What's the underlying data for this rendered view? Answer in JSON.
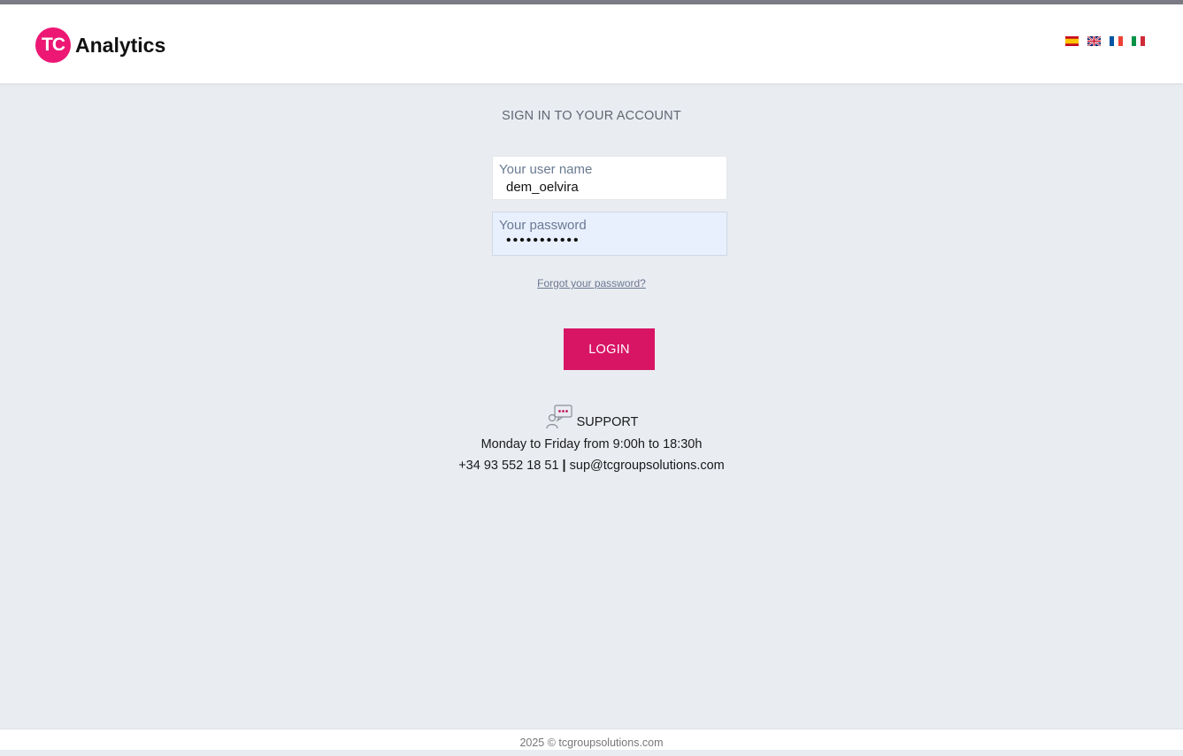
{
  "header": {
    "logo_badge": "TC",
    "logo_text": "Analytics",
    "languages": [
      {
        "name": "spanish-flag-icon"
      },
      {
        "name": "english-flag-icon"
      },
      {
        "name": "french-flag-icon"
      },
      {
        "name": "italian-flag-icon"
      }
    ]
  },
  "login": {
    "title": "SIGN IN TO YOUR ACCOUNT",
    "username_label": "Your user name",
    "username_value": "dem_oelvira",
    "password_label": "Your password",
    "password_value": "•••••••••••",
    "forgot_link": "Forgot your password?",
    "login_button": "LOGIN"
  },
  "support": {
    "icon": "support-chat-icon",
    "label": "SUPPORT",
    "hours": "Monday to Friday from 9:00h to 18:30h",
    "phone": "+34 93 552 18 51",
    "separator": "|",
    "email": "sup@tcgroupsolutions.com"
  },
  "footer": {
    "copyright": "2025 © tcgroupsolutions.com"
  },
  "colors": {
    "accent": "#ec1874",
    "button": "#d81565",
    "background": "#e9ecf1"
  }
}
